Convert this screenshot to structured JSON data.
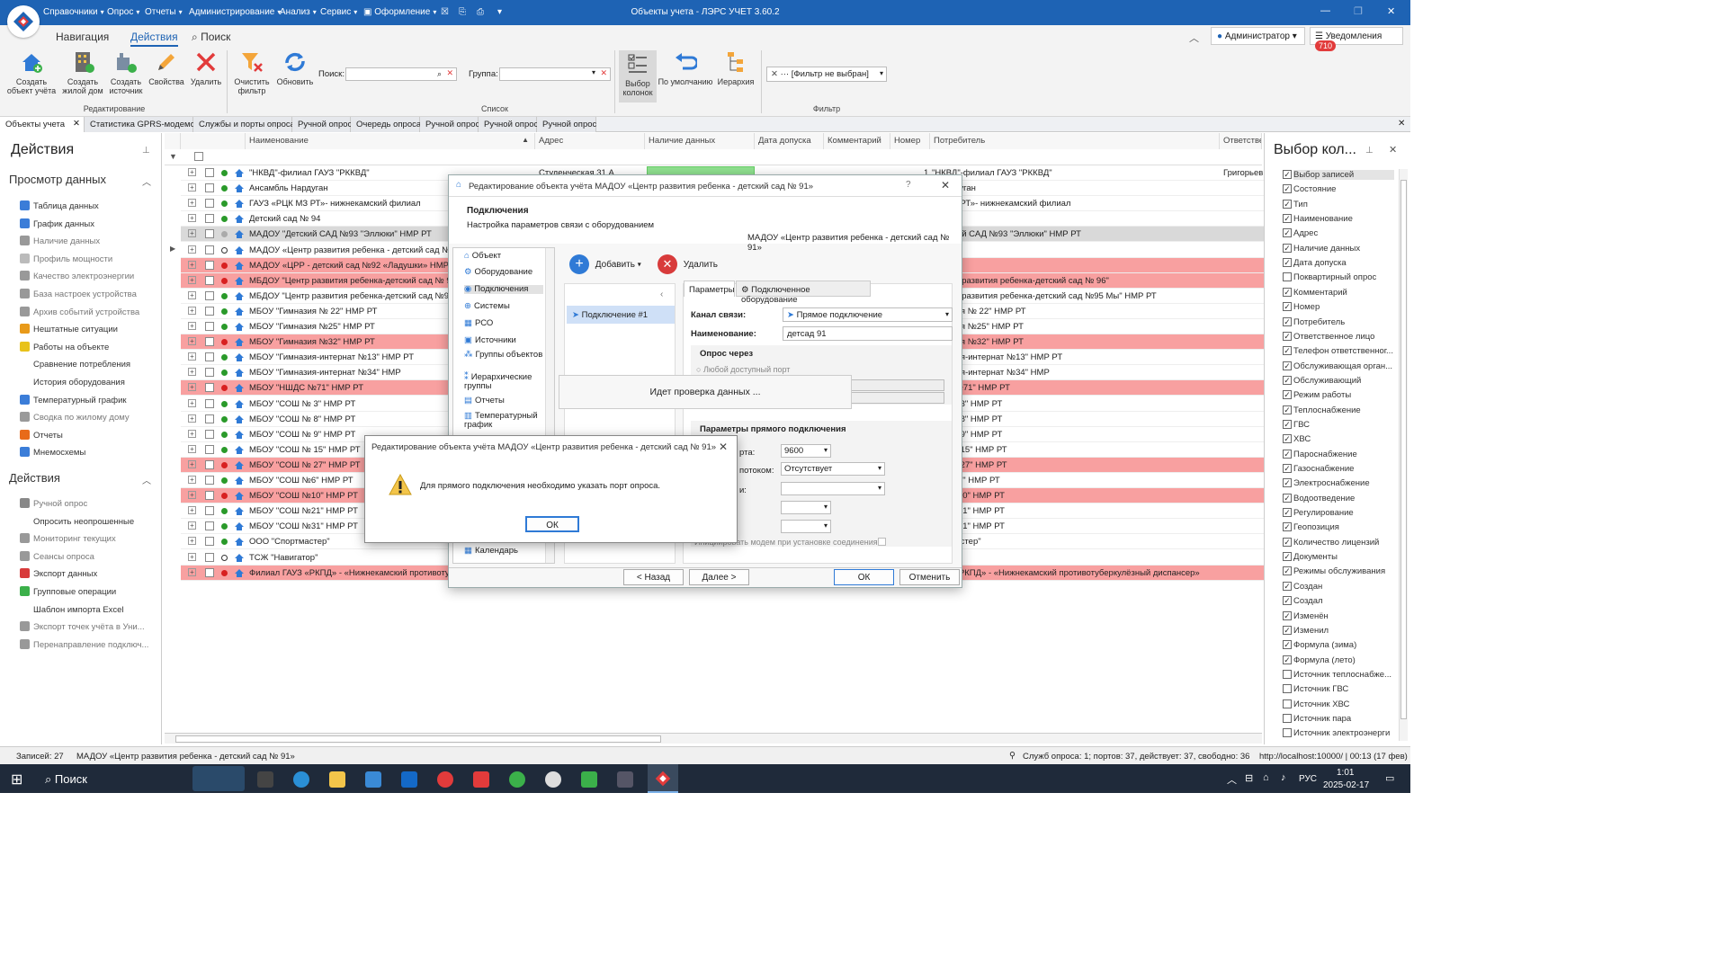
{
  "app": {
    "title": "Объекты учета - ЛЭРС УЧЕТ 3.60.2",
    "user": "Администратор",
    "notifications_label": "Уведомления",
    "notifications_count": "710"
  },
  "menu": [
    "Справочники",
    "Опрос",
    "Отчеты",
    "Администрирование",
    "Анализ",
    "Сервис",
    "Оформление"
  ],
  "ribbon": {
    "tabs": [
      "Навигация",
      "Действия",
      "Поиск"
    ],
    "buttons": {
      "create_object": "Создать объект учёта",
      "create_house": "Создать жилой дом",
      "create_source": "Создать источник",
      "properties": "Свойства",
      "delete": "Удалить",
      "clear_filter": "Очистить фильтр",
      "refresh": "Обновить",
      "column_choice": "Выбор колонок",
      "default": "По умолчанию",
      "hierarchy": "Иерархия"
    },
    "search_label": "Поиск:",
    "group_label": "Группа:",
    "filter_value": "[Фильтр не выбран]",
    "groups": {
      "editing": "Редактирование",
      "list": "Список",
      "filter": "Фильтр"
    }
  },
  "doctabs": [
    "Объекты учета",
    "Статистика GPRS-модемов",
    "Службы и порты опроса",
    "Ручной опрос",
    "Очередь опроса",
    "Ручной опрос",
    "Ручной опрос",
    "Ручной опрос"
  ],
  "left": {
    "title": "Действия",
    "section1": "Просмотр данных",
    "items1": [
      {
        "label": "Таблица данных",
        "color": "#3b7dd8"
      },
      {
        "label": "График данных",
        "color": "#3b7dd8"
      },
      {
        "label": "Наличие данных",
        "color": "#999"
      },
      {
        "label": "Профиль мощности",
        "color": "#bbb"
      },
      {
        "label": "Качество электроэнергии",
        "color": "#999"
      },
      {
        "label": "База настроек устройства",
        "color": "#999"
      },
      {
        "label": "Архив событий устройства",
        "color": "#999"
      },
      {
        "label": "Нештатные ситуации",
        "color": "#e89a1a"
      },
      {
        "label": "Работы на объекте",
        "color": "#e8c21a"
      },
      {
        "label": "Сравнение потребления",
        "color": ""
      },
      {
        "label": "История оборудования",
        "color": ""
      },
      {
        "label": "Температурный график",
        "color": "#3b7dd8"
      },
      {
        "label": "Сводка по жилому дому",
        "color": "#999"
      },
      {
        "label": "Отчеты",
        "color": "#e86a1a"
      },
      {
        "label": "Мнемосхемы",
        "color": "#3b7dd8"
      }
    ],
    "section2": "Действия",
    "items2": [
      {
        "label": "Ручной опрос",
        "color": "#888"
      },
      {
        "label": "Опросить неопрошенные",
        "color": ""
      },
      {
        "label": "Мониторинг текущих",
        "color": "#999"
      },
      {
        "label": "Сеансы опроса",
        "color": "#999"
      },
      {
        "label": "Экспорт данных",
        "color": "#d83b3b"
      },
      {
        "label": "Групповые операции",
        "color": "#3bb04a"
      },
      {
        "label": "Шаблон импорта Excel",
        "color": ""
      },
      {
        "label": "Экспорт точек учёта в Уни...",
        "color": "#999"
      },
      {
        "label": "Перенаправление подключ...",
        "color": "#999"
      }
    ]
  },
  "grid": {
    "headers": [
      "Наименование",
      "Адрес",
      "Наличие данных",
      "Дата допуска",
      "Комментарий",
      "Номер",
      "Потребитель",
      "Ответстве"
    ],
    "rows": [
      {
        "name": "\"НКВД\"-филиал ГАУЗ \"РККВД\"",
        "address": "Студенческая 31 А",
        "number": "1",
        "consumer": "\"НКВД\"-филиал ГАУЗ \"РККВД\"",
        "resp": "Григорьев",
        "status": "g",
        "style": ""
      },
      {
        "name": "Ансамбль Нардуган",
        "consumer": "ь Нардуган",
        "status": "g",
        "style": ""
      },
      {
        "name": "ГАУЗ «РЦК МЗ РТ»- нижнекамский филиал",
        "consumer": "ЦК МЗ РТ»- нижнекамский филиал",
        "status": "g",
        "style": ""
      },
      {
        "name": "Детский сад № 94",
        "consumer": "д № 94",
        "status": "g",
        "style": ""
      },
      {
        "name": "МАДОУ \"Детский САД №93 \"Эллюки\" НМР РТ",
        "consumer": "\"Детский САД №93 \"Эллюки\" НМР РТ",
        "status": "w",
        "style": "sel"
      },
      {
        "name": "МАДОУ «Центр развития ребенка - детский сад № 91»",
        "consumer": "",
        "status": "o",
        "style": ""
      },
      {
        "name": "МАДОУ «ЦРР - детский сад №92 «Ладушки» НМР РТ",
        "consumer": "",
        "status": "r",
        "style": "red"
      },
      {
        "name": "МБДОУ \"Центр развития ребенка-детский сад № 96\"",
        "consumer": "\"Центр развития ребенка-детский сад № 96\"",
        "status": "r",
        "style": "red"
      },
      {
        "name": "МБДОУ \"Центр развития ребенка-детский сад №95 Мы\" НМР РТ",
        "consumer": "\"Центр развития ребенка-детский сад №95 Мы\" НМР РТ",
        "status": "g",
        "style": ""
      },
      {
        "name": "МБОУ \"Гимназия № 22\" НМР РТ",
        "consumer": "имназия № 22\" НМР РТ",
        "status": "g",
        "style": ""
      },
      {
        "name": "МБОУ \"Гимназия №25\" НМР РТ",
        "consumer": "имназия №25\" НМР РТ",
        "status": "g",
        "style": ""
      },
      {
        "name": "МБОУ \"Гимназия №32\" НМР РТ",
        "consumer": "имназия №32\" НМР РТ",
        "status": "r",
        "style": "red"
      },
      {
        "name": "МБОУ \"Гимназия-интернат №13\" НМР РТ",
        "consumer": "имназия-интернат №13\" НМР РТ",
        "status": "g",
        "style": ""
      },
      {
        "name": "МБОУ \"Гимназия-интернат №34\" НМР",
        "consumer": "имназия-интернат №34\" НМР",
        "status": "g",
        "style": ""
      },
      {
        "name": "МБОУ \"НШДС №71\" НМР РТ",
        "consumer": "ШДС №71\" НМР РТ",
        "status": "r",
        "style": "red"
      },
      {
        "name": "МБОУ \"СОШ № 3\" НМР РТ",
        "consumer": "ОШ № 3\" НМР РТ",
        "status": "g",
        "style": ""
      },
      {
        "name": "МБОУ \"СОШ № 8\" НМР РТ",
        "consumer": "ОШ № 8\" НМР РТ",
        "status": "g",
        "style": ""
      },
      {
        "name": "МБОУ \"СОШ № 9\" НМР РТ",
        "consumer": "ОШ № 9\" НМР РТ",
        "status": "g",
        "style": ""
      },
      {
        "name": "МБОУ \"СОШ № 15\" НМР РТ",
        "consumer": "ОШ № 15\" НМР РТ",
        "status": "g",
        "style": ""
      },
      {
        "name": "МБОУ \"СОШ № 27\" НМР РТ",
        "consumer": "ОШ № 27\" НМР РТ",
        "status": "r",
        "style": "red"
      },
      {
        "name": "МБОУ \"СОШ №6\" НМР РТ",
        "consumer": "ОШ №6\" НМР РТ",
        "status": "g",
        "style": ""
      },
      {
        "name": "МБОУ \"СОШ №10\" НМР РТ",
        "consumer": "ОШ №10\" НМР РТ",
        "status": "r",
        "style": "red"
      },
      {
        "name": "МБОУ \"СОШ №21\" НМР РТ",
        "consumer": "ОШ №21\" НМР РТ",
        "status": "g",
        "style": ""
      },
      {
        "name": "МБОУ \"СОШ №31\" НМР РТ",
        "consumer": "ОШ №31\" НМР РТ",
        "status": "g",
        "style": ""
      },
      {
        "name": "ООО \"Спортмастер\"",
        "consumer": "портмастер\"",
        "status": "g",
        "style": ""
      },
      {
        "name": "ТСЖ \"Навигатор\"",
        "consumer": "",
        "status": "o",
        "style": ""
      },
      {
        "name": "Филиал ГАУЗ «РКПД» - «Нижнекамский противотуберкулёзный диспансер»",
        "consumer": "ГАУЗ «РКПД» - «Нижнекамский противотуберкулёзный диспансер»",
        "status": "r",
        "style": "red"
      }
    ]
  },
  "right": {
    "title": "Выбор кол...",
    "items": [
      {
        "label": "Выбор записей",
        "checked": true
      },
      {
        "label": "Состояние",
        "checked": true
      },
      {
        "label": "Тип",
        "checked": true
      },
      {
        "label": "Наименование",
        "checked": true
      },
      {
        "label": "Адрес",
        "checked": true
      },
      {
        "label": "Наличие данных",
        "checked": true
      },
      {
        "label": "Дата допуска",
        "checked": true
      },
      {
        "label": "Поквартирный опрос",
        "checked": false
      },
      {
        "label": "Комментарий",
        "checked": true
      },
      {
        "label": "Номер",
        "checked": true
      },
      {
        "label": "Потребитель",
        "checked": true
      },
      {
        "label": "Ответственное лицо",
        "checked": true
      },
      {
        "label": "Телефон ответственног...",
        "checked": true
      },
      {
        "label": "Обслуживающая орган...",
        "checked": true
      },
      {
        "label": "Обслуживающий",
        "checked": true
      },
      {
        "label": "Режим работы",
        "checked": true
      },
      {
        "label": "Теплоснабжение",
        "checked": true
      },
      {
        "label": "ГВС",
        "checked": true
      },
      {
        "label": "ХВС",
        "checked": true
      },
      {
        "label": "Пароснабжение",
        "checked": true
      },
      {
        "label": "Газоснабжение",
        "checked": true
      },
      {
        "label": "Электроснабжение",
        "checked": true
      },
      {
        "label": "Водоотведение",
        "checked": true
      },
      {
        "label": "Регулирование",
        "checked": true
      },
      {
        "label": "Геопозиция",
        "checked": true
      },
      {
        "label": "Количество лицензий",
        "checked": true
      },
      {
        "label": "Документы",
        "checked": true
      },
      {
        "label": "Режимы обслуживания",
        "checked": true
      },
      {
        "label": "Создан",
        "checked": true
      },
      {
        "label": "Создал",
        "checked": true
      },
      {
        "label": "Изменён",
        "checked": true
      },
      {
        "label": "Изменил",
        "checked": true
      },
      {
        "label": "Формула (зима)",
        "checked": true
      },
      {
        "label": "Формула (лето)",
        "checked": true
      },
      {
        "label": "Источник теплоснабже...",
        "checked": false
      },
      {
        "label": "Источник ГВС",
        "checked": false
      },
      {
        "label": "Источник ХВС",
        "checked": false
      },
      {
        "label": "Источник пара",
        "checked": false
      },
      {
        "label": "Источник электроэнерги",
        "checked": false
      }
    ]
  },
  "status": {
    "records": "Записей: 27",
    "selected": "МАДОУ «Центр развития ребенка - детский сад № 91»",
    "services": "Служб опроса: 1; портов: 37, действует: 37, свободно: 36",
    "server": "http://localhost:10000/ | 00:13 (17 фев)"
  },
  "taskbar": {
    "search": "Поиск",
    "lang": "РУС",
    "time": "1:01",
    "date": "2025-02-17"
  },
  "dialog": {
    "title": "Редактирование объекта учёта МАДОУ «Центр развития ребенка - детский сад № 91»",
    "section": "Подключения",
    "subtitle": "Настройка параметров связи с оборудованием",
    "object": "МАДОУ «Центр развития ребенка - детский сад № 91»",
    "nav": [
      "Объект",
      "Оборудование",
      "Подключения",
      "Системы",
      "РСО",
      "Источники",
      "Группы объектов",
      "Иерархические группы",
      "Отчеты",
      "Температурный график",
      "Календарь"
    ],
    "add": "Добавить",
    "delete": "Удалить",
    "connection": "Подключение #1",
    "tab_params": "Параметры",
    "tab_equipment": "Подключенное оборудование",
    "channel_label": "Канал связи:",
    "channel_value": "Прямое подключение",
    "name_label": "Наименование:",
    "name_value": "детсад 91",
    "poll_through": "Опрос через",
    "any_port": "Любой доступный порт",
    "checking": "Идет проверка данных ...",
    "direct_params": "Параметры прямого подключения",
    "baud_label": "рта:",
    "baud_value": "9600",
    "flow_label": "потоком:",
    "flow_value": "Отсутствует",
    "other_label": "и:",
    "init_modem": "Инициировать модем при установке соединения",
    "back": "< Назад",
    "next": "Далее >",
    "ok": "ОК",
    "cancel": "Отменить"
  },
  "message": {
    "title": "Редактирование объекта учёта МАДОУ «Центр развития ребенка - детский сад № 91»",
    "text": "Для прямого подключения необходимо указать порт опроса.",
    "ok": "ОК"
  }
}
